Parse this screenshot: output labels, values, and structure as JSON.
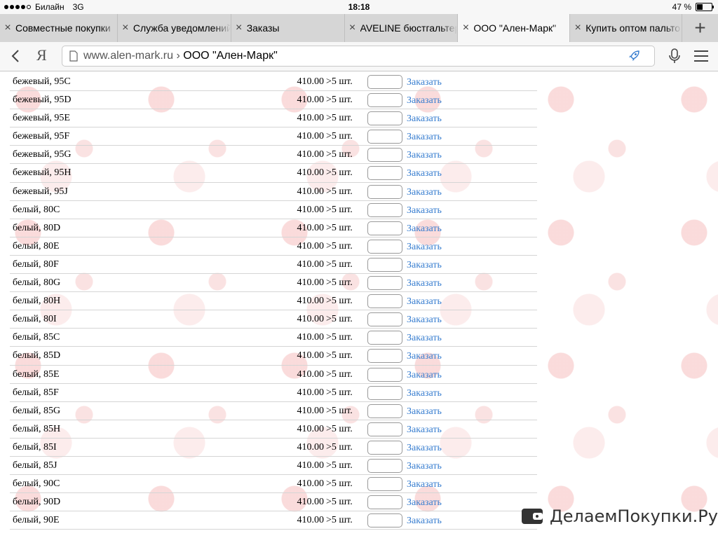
{
  "status": {
    "carrier": "Билайн",
    "network": "3G",
    "time": "18:18",
    "battery": "47 %",
    "battery_fraction": 0.47
  },
  "tabs": [
    {
      "label": "Совместные покупки",
      "active": false
    },
    {
      "label": "Служба уведомлений",
      "active": false
    },
    {
      "label": "Заказы",
      "active": false
    },
    {
      "label": "AVELINE бюстгальтеры",
      "active": false
    },
    {
      "label": "ООО \"Ален-Марк\"",
      "active": true
    },
    {
      "label": "Купить оптом пальто",
      "active": false
    }
  ],
  "toolbar": {
    "ya_label": "Я",
    "url_host": "www.alen-mark.ru",
    "url_sep": " › ",
    "url_title": "ООО \"Ален-Марк\""
  },
  "table": {
    "order_label": "Заказать",
    "rows": [
      {
        "name": "бежевый, 95C",
        "price": "410.00",
        "stock": ">5 шт."
      },
      {
        "name": "бежевый, 95D",
        "price": "410.00",
        "stock": ">5 шт."
      },
      {
        "name": "бежевый, 95E",
        "price": "410.00",
        "stock": ">5 шт."
      },
      {
        "name": "бежевый, 95F",
        "price": "410.00",
        "stock": ">5 шт."
      },
      {
        "name": "бежевый, 95G",
        "price": "410.00",
        "stock": ">5 шт."
      },
      {
        "name": "бежевый, 95H",
        "price": "410.00",
        "stock": ">5 шт."
      },
      {
        "name": "бежевый, 95J",
        "price": "410.00",
        "stock": ">5 шт."
      },
      {
        "name": "белый, 80C",
        "price": "410.00",
        "stock": ">5 шт."
      },
      {
        "name": "белый, 80D",
        "price": "410.00",
        "stock": ">5 шт."
      },
      {
        "name": "белый, 80E",
        "price": "410.00",
        "stock": ">5 шт."
      },
      {
        "name": "белый, 80F",
        "price": "410.00",
        "stock": ">5 шт."
      },
      {
        "name": "белый, 80G",
        "price": "410.00",
        "stock": ">5 шт."
      },
      {
        "name": "белый, 80H",
        "price": "410.00",
        "stock": ">5 шт."
      },
      {
        "name": "белый, 80I",
        "price": "410.00",
        "stock": ">5 шт."
      },
      {
        "name": "белый, 85C",
        "price": "410.00",
        "stock": ">5 шт."
      },
      {
        "name": "белый, 85D",
        "price": "410.00",
        "stock": ">5 шт."
      },
      {
        "name": "белый, 85E",
        "price": "410.00",
        "stock": ">5 шт."
      },
      {
        "name": "белый, 85F",
        "price": "410.00",
        "stock": ">5 шт."
      },
      {
        "name": "белый, 85G",
        "price": "410.00",
        "stock": ">5 шт."
      },
      {
        "name": "белый, 85H",
        "price": "410.00",
        "stock": ">5 шт."
      },
      {
        "name": "белый, 85I",
        "price": "410.00",
        "stock": ">5 шт."
      },
      {
        "name": "белый, 85J",
        "price": "410.00",
        "stock": ">5 шт."
      },
      {
        "name": "белый, 90C",
        "price": "410.00",
        "stock": ">5 шт."
      },
      {
        "name": "белый, 90D",
        "price": "410.00",
        "stock": ">5 шт."
      },
      {
        "name": "белый, 90E",
        "price": "410.00",
        "stock": ">5 шт."
      }
    ]
  },
  "watermark": {
    "text": "ДелаемПокупки.Ру"
  },
  "colors": {
    "link": "#3a7fd0",
    "pattern": "#f5bebe",
    "rocket": "#3a7fd0"
  },
  "icons": [
    "close-icon",
    "plus-icon",
    "back-arrow-icon",
    "page-icon",
    "rocket-icon",
    "microphone-icon",
    "hamburger-menu-icon",
    "wallet-icon"
  ]
}
